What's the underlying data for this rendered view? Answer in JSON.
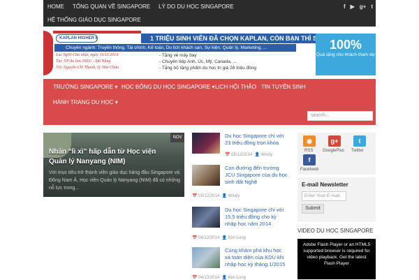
{
  "topnav": {
    "row1": [
      "HOME",
      "TỔNG QUAN VỀ SINGAPORE",
      "LÝ DO DU HỌC SINGAPORE"
    ],
    "row2": [
      "HỆ THỐNG GIÁO DỤC SINGAPORE"
    ],
    "social": [
      "f",
      "▶",
      "g+",
      "t"
    ]
  },
  "banner": {
    "headline": "1 TRIỆU SINH VIÊN ĐÃ CHỌN KAPLAN, CÒN BẠN THÌ SAO???",
    "kaplan": "KAPLAN HIGHER EDUCATION",
    "majors": "Chuyên ngành: Truyền thông, Tài chính, Kế toán, Du lịch khách sạn, Sự kiện, Quản lý, Marketing, ...",
    "event": [
      "Lúc 9g00 Chủ nhật, ngày 16/11/2014",
      "Tại: VP du học INEC - Đà Nẵng",
      "51L Nguyễn Chí Thanh, Q. Hải Châu"
    ],
    "gifts": [
      "- Tặng vé máy bay",
      "- Chuyên tiếp Anh, Úc, Mỹ, Canada, ...",
      "- Tặng bộ tặng phẩm du học trị giá 28 triệu đồng"
    ],
    "pct": "100%",
    "pct_sub": "Quà tặng cho khách tham dự"
  },
  "mainnav": {
    "items": [
      "TRƯỜNG SINGAPORE ▾",
      "HỌC BỔNG DU HỌC SINGAPORE ▾",
      "LỊCH HỘI THẢO",
      "TIN TUYỂN SINH",
      "HÀNH TRANG DU HỌC ▾"
    ],
    "search_placeholder": "search..."
  },
  "featured": {
    "title": "Nhận “lì xì” hấp dẫn từ Học viện Quản lý Nanyang (NIM)",
    "excerpt": "Với mục tiêu trở thành viện giáo dục hàng đầu Singapore và Đông Nam Á, Học viện Quản lý Nanyang (NIM) đã có những nỗ lực trong...",
    "date": "NOV"
  },
  "posts": [
    {
      "title": "Du học Singapore chỉ với 23 triệu đồng trọn khóa",
      "date": "05/12/2014",
      "author": "Windy"
    },
    {
      "title": "Con đường đến trường JCU Singapore của du học sinh đất Nghệ",
      "date": "05/12/2014",
      "author": "Windy"
    },
    {
      "title": "Du học Singapore chỉ với 15.5 triệu đồng cho kỳ nhập học năm 2014",
      "date": "04/12/2014",
      "author": "Kim Long"
    },
    {
      "title": "Cùng khám phá khu học xá toàn diện của KDU khi nhập học kỳ tháng 1/2015",
      "date": "04/12/2014",
      "author": "Kim Long"
    }
  ],
  "sidebar": {
    "social_labels": [
      "RSS",
      "GooglePlus",
      "Twitter",
      "Facebook"
    ],
    "newsletter_title": "E-mail Newsletter",
    "email_placeholder": "Enter Your E-mail",
    "submit": "Submit",
    "video_heading": "VIDEO DU HỌC SINGAPORE",
    "video_text": "Adobe Flash Player or an HTML5 supported browser is required for video playback. Get the latest Flash Player"
  }
}
